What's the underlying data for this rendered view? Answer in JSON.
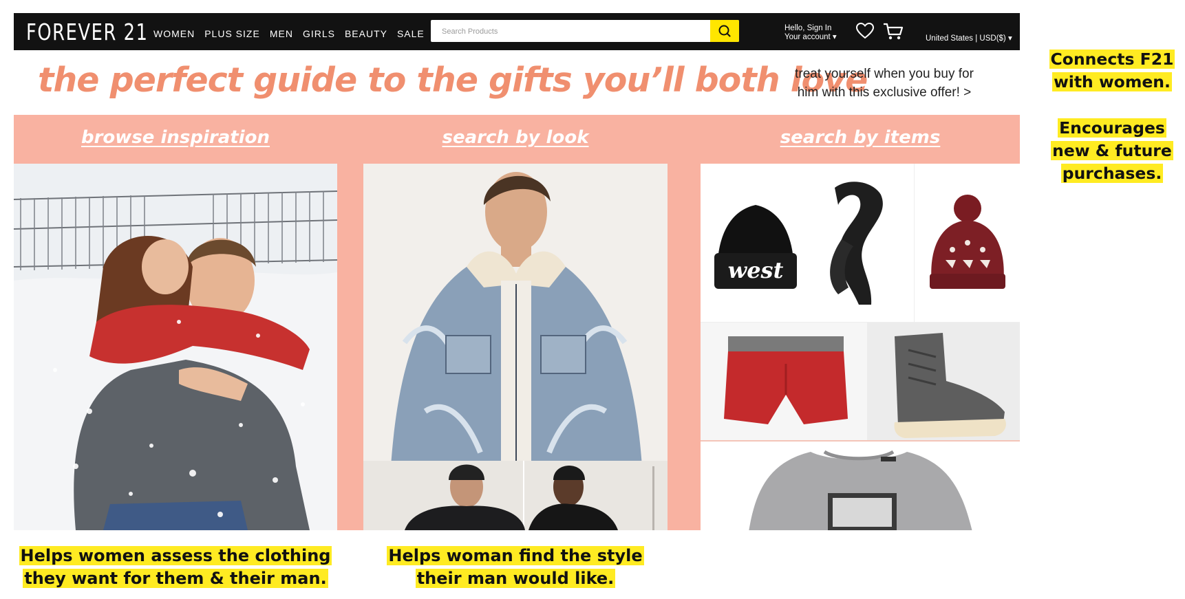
{
  "header": {
    "logo": "FOREVER 21",
    "nav": [
      "WOMEN",
      "PLUS SIZE",
      "MEN",
      "GIRLS",
      "BEAUTY",
      "SALE"
    ],
    "search_placeholder": "Search Products",
    "account_line1": "Hello, Sign In",
    "account_line2": "Your account",
    "region": "United States | USD($)"
  },
  "banner": {
    "headline": "the perfect guide to the gifts you’ll both love",
    "offer_line1": "treat yourself when you buy for",
    "offer_line2": "him with this exclusive offer! >"
  },
  "sections": {
    "browse": "browse inspiration",
    "look": "search by look",
    "items": "search by items"
  },
  "product_text": {
    "beanie_text": "west"
  },
  "annotations": {
    "bottom_left_line1": "Helps women assess the clothing",
    "bottom_left_line2": "they want for them & their man.",
    "bottom_mid_line1": "Helps woman find the style",
    "bottom_mid_line2": "their man would like.",
    "side_line1": "Connects F21",
    "side_line2": "with women.",
    "side_line3": "Encourages",
    "side_line4": "new & future",
    "side_line5": "purchases."
  },
  "colors": {
    "nav_bg": "#121212",
    "accent_yellow": "#ffe600",
    "salmon": "#f9b2a1",
    "headline": "#f08f6f",
    "highlight": "#ffeb22"
  }
}
